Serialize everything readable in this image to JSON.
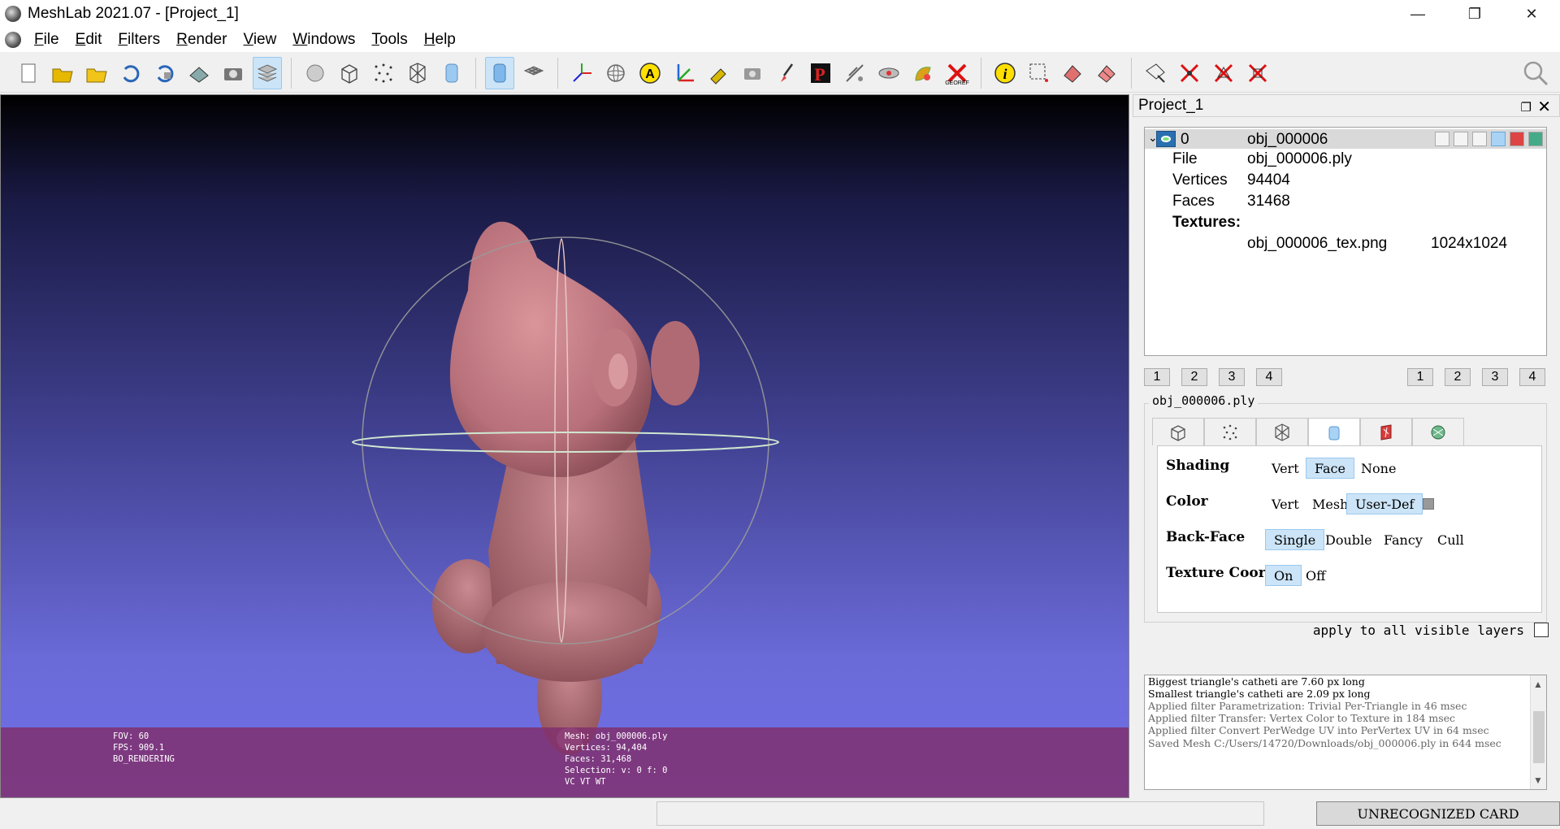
{
  "window": {
    "title": "MeshLab 2021.07 - [Project_1]"
  },
  "menu": [
    "File",
    "Edit",
    "Filters",
    "Render",
    "View",
    "Windows",
    "Tools",
    "Help"
  ],
  "toolbar_icons": [
    "new-project-icon",
    "open-project-icon",
    "import-mesh-icon",
    "reload-icon",
    "reload-all-icon",
    "export-mesh-icon",
    "snapshot-icon",
    "layers-icon",
    "raster-layers-icon",
    "bbox-icon",
    "points-icon",
    "wireframe-icon",
    "flat-shading-icon",
    "smooth-shading-icon",
    "grid-icon",
    "axis-icon",
    "trackball-icon",
    "annotation-icon",
    "measure-icon",
    "paint-icon",
    "raster-align-icon",
    "brush-icon",
    "pickpoints-icon",
    "align-icon",
    "manipulator-icon",
    "texture-icon",
    "georef-icon",
    "info-icon",
    "select-vertices-icon",
    "select-faces-icon",
    "select-connected-icon",
    "select-area-icon",
    "delete-vertices-icon",
    "delete-faces-icon",
    "delete-all-icon"
  ],
  "viewport": {
    "left_info": [
      "FOV: 60",
      "FPS:   909.1",
      "BO_RENDERING"
    ],
    "right_info": [
      "Mesh: obj_000006.ply",
      "Vertices: 94,404",
      "Faces: 31,468",
      "Selection: v: 0 f: 0",
      "VC VT WT"
    ],
    "mesh_color": "#c07a80",
    "info_strip_color": "#80306e"
  },
  "panel": {
    "title": "Project_1",
    "layer": {
      "id": "0",
      "name": "obj_000006",
      "file_label": "File",
      "file_value": "obj_000006.ply",
      "vertices_label": "Vertices",
      "vertices_value": "94404",
      "faces_label": "Faces",
      "faces_value": "31468",
      "textures_label": "Textures:",
      "texture_name": "obj_000006_tex.png",
      "texture_size": "1024x1024"
    },
    "pager_left": [
      "1",
      "2",
      "3",
      "4"
    ],
    "pager_right": [
      "1",
      "2",
      "3",
      "4"
    ],
    "render_group": "obj_000006.ply",
    "options": {
      "shading": {
        "label": "Shading",
        "choices": [
          "Vert",
          "Face",
          "None"
        ],
        "selected": "Face"
      },
      "color": {
        "label": "Color",
        "choices": [
          "Vert",
          "Mesh",
          "User-Def"
        ],
        "selected": "User-Def"
      },
      "backface": {
        "label": "Back-Face",
        "choices": [
          "Single",
          "Double",
          "Fancy",
          "Cull"
        ],
        "selected": "Single"
      },
      "texcoord": {
        "label": "Texture Coord",
        "choices": [
          "On",
          "Off"
        ],
        "selected": "On"
      }
    },
    "apply_all": "apply to all visible layers",
    "log": [
      "Biggest triangle's catheti are 7.60 px long",
      "Smallest triangle's catheti are 2.09 px long",
      "Applied filter Parametrization: Trivial Per-Triangle in 46 msec",
      "Applied filter Transfer: Vertex Color to Texture in 184 msec",
      "Applied filter Convert PerWedge UV into PerVertex UV in 64 msec",
      "Saved Mesh C:/Users/14720/Downloads/obj_000006.ply in 644 msec"
    ]
  },
  "status": {
    "gpu": "UNRECOGNIZED CARD"
  }
}
